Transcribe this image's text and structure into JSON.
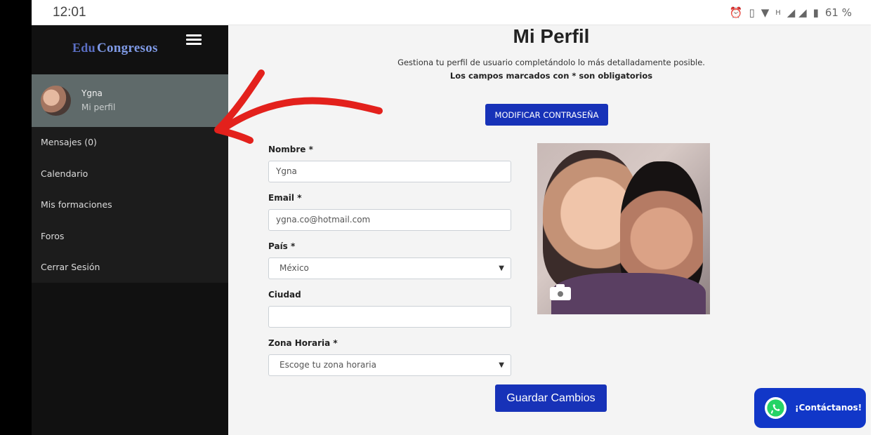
{
  "status_bar": {
    "time": "12:01",
    "icons": [
      "alarm-icon",
      "vibrate-icon",
      "wifi-icon",
      "signal-icon",
      "battery-icon"
    ],
    "network": "H",
    "battery": "61 %"
  },
  "sidebar": {
    "logo_text": "Congresos",
    "logo_mark": "Edu",
    "user": {
      "name": "Ygna",
      "link": "Mi perfil"
    },
    "items": [
      {
        "label": "Mensajes (0)"
      },
      {
        "label": "Calendario"
      },
      {
        "label": "Mis formaciones"
      },
      {
        "label": "Foros"
      },
      {
        "label": "Cerrar Sesión"
      }
    ]
  },
  "main": {
    "title": "Mi Perfil",
    "subtitle": "Gestiona tu perfil de usuario completándolo lo más detalladamente posible.",
    "note": "Los campos marcados con * son obligatorios",
    "change_password": "MODIFICAR CONTRASEÑA",
    "form": {
      "nombre": {
        "label": "Nombre *",
        "value": "Ygna"
      },
      "email": {
        "label": "Email *",
        "value": "ygna.co@hotmail.com"
      },
      "pais": {
        "label": "País *",
        "value": "México"
      },
      "ciudad": {
        "label": "Ciudad",
        "value": ""
      },
      "zona": {
        "label": "Zona Horaria *",
        "value": "Escoge tu zona horaria"
      }
    },
    "save_button": "Guardar Cambios"
  },
  "contact_button": {
    "label": "¡Contáctanos!",
    "icon": "whatsapp-icon"
  },
  "colors": {
    "accent": "#1732b8",
    "sidebar_bg": "#111111",
    "user_card_bg": "#5f6a6a",
    "annotation_red": "#e3211c"
  }
}
